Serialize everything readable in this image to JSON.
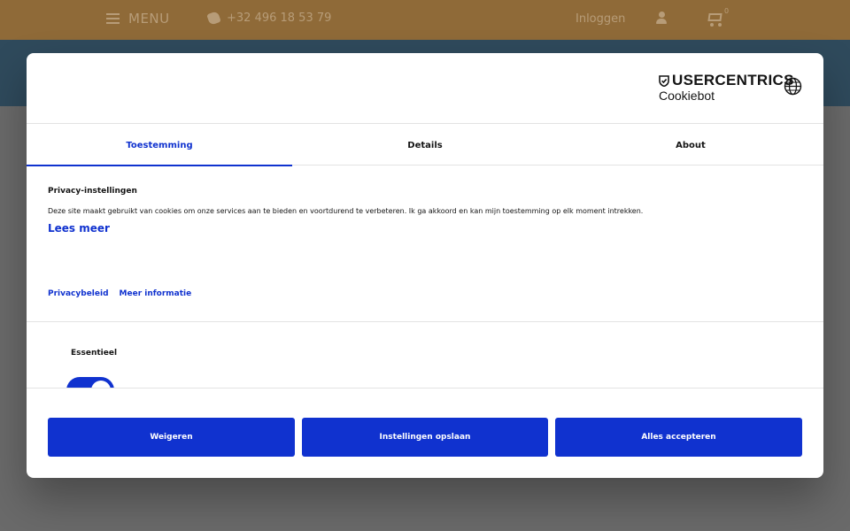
{
  "site": {
    "menu_label": "MENU",
    "phone": "+32 496 18 53 79",
    "login_label": "Inloggen",
    "cart_count": "0",
    "colors": {
      "header_bg": "#8f6a38",
      "band_bg": "#2f4a5c"
    }
  },
  "dialog": {
    "brand": {
      "name": "USERCENTRICS",
      "product": "Cookiebot"
    },
    "language_icon": "globe-icon",
    "tabs": [
      {
        "label": "Toestemming",
        "active": true
      },
      {
        "label": "Details",
        "active": false
      },
      {
        "label": "About",
        "active": false
      }
    ],
    "consent": {
      "title": "Privacy-instellingen",
      "text": "Deze site maakt gebruikt van cookies om onze services aan te bieden en voortdurend te verbeteren.  Ik ga akkoord en kan mijn toestemming op elk moment intrekken.",
      "read_more": "Lees meer",
      "links": {
        "privacy": "Privacybeleid",
        "more_info": "Meer informatie"
      }
    },
    "categories": [
      {
        "label": "Essentieel",
        "enabled": true
      }
    ],
    "buttons": {
      "deny": "Weigeren",
      "save": "Instellingen opslaan",
      "accept_all": "Alles accepteren"
    },
    "colors": {
      "accent": "#1032cf",
      "text": "#141414",
      "divider": "#e3e3e3"
    }
  }
}
